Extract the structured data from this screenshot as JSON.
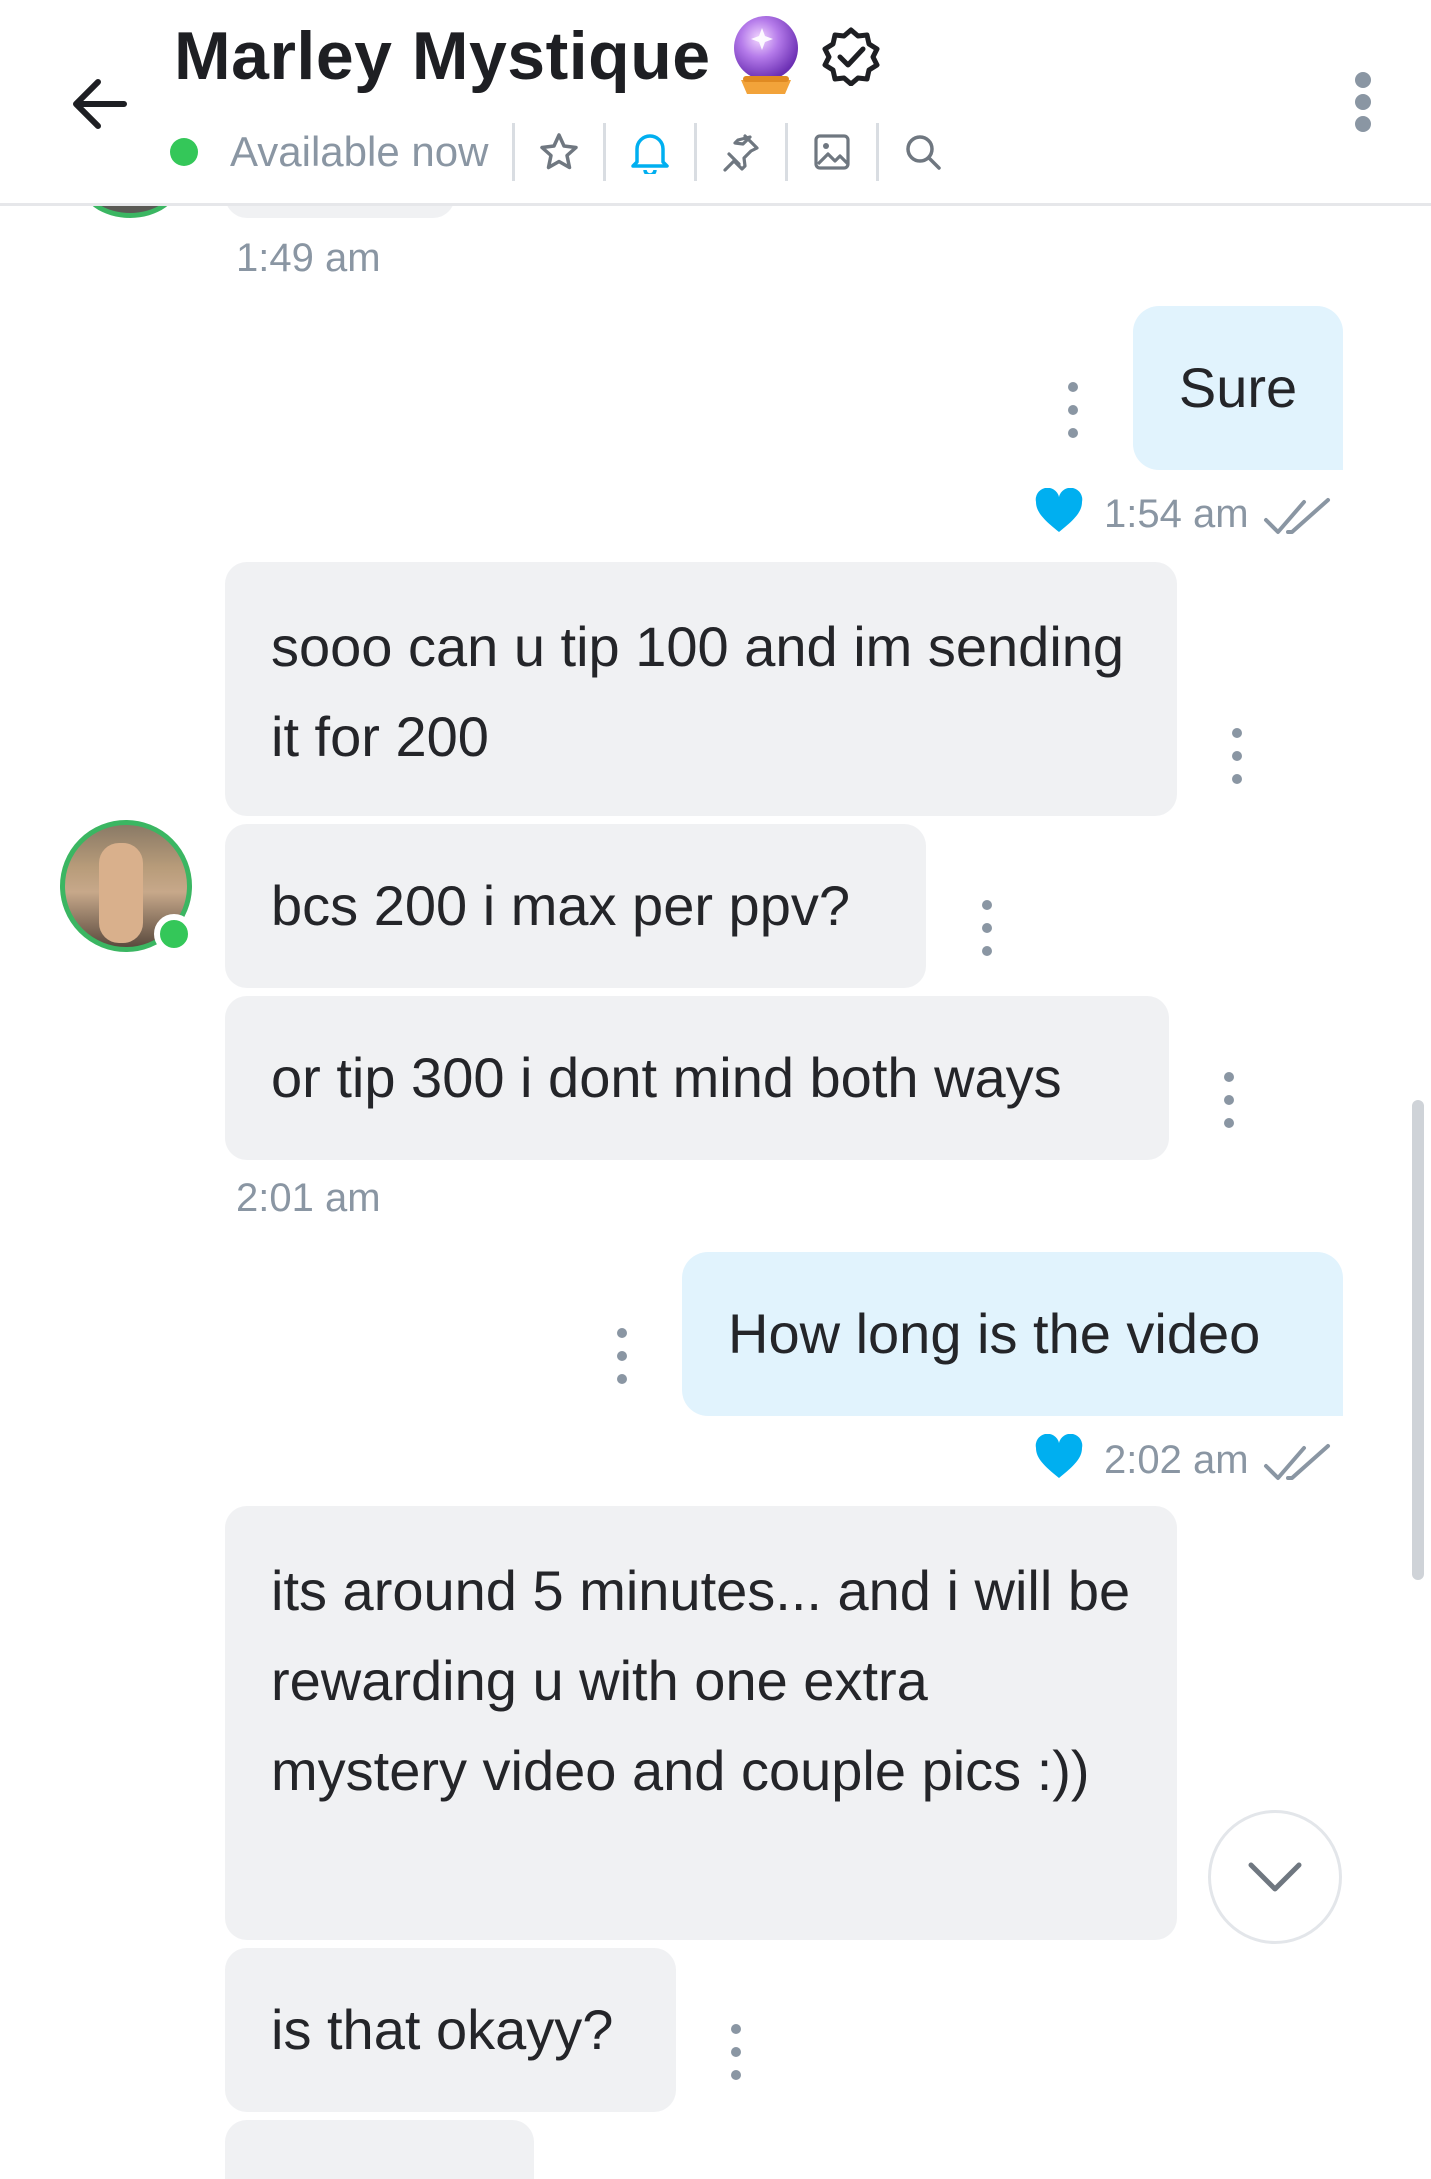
{
  "header": {
    "title": "Marley Mystique",
    "status": "Available now",
    "icons": [
      "star-icon",
      "bell-icon",
      "pin-icon",
      "image-icon",
      "search-icon"
    ]
  },
  "colors": {
    "accent": "#00aff0",
    "online": "#34c759",
    "incoming_bubble": "#f0f1f3",
    "outgoing_bubble": "#e1f3fd",
    "muted_text": "#8a96a3"
  },
  "messages": {
    "t0": "1:49 am",
    "m1": "Sure",
    "t1": "1:54 am",
    "m2": "sooo can u tip 100 and im sending it for 200",
    "m3": "bcs 200 i max per ppv?",
    "m4": "or tip 300 i dont mind both ways",
    "t2": "2:01 am",
    "m5": "How long is the video",
    "t3": "2:02 am",
    "m6": "its around 5 minutes... and i will be rewarding u with one extra mystery video and couple pics :))",
    "m7": "is that okayy?"
  }
}
